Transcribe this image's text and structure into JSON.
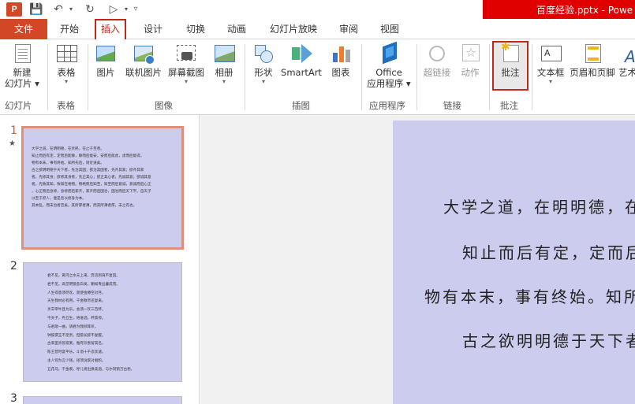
{
  "window": {
    "title": "百度经验.pptx - Powe",
    "logo": "P"
  },
  "tabs": [
    "文件",
    "开始",
    "插入",
    "设计",
    "切换",
    "动画",
    "幻灯片放映",
    "审阅",
    "视图"
  ],
  "ribbon": {
    "new_slide_1": "新建",
    "new_slide_2": "幻灯片",
    "table": "表格",
    "picture": "图片",
    "online_picture": "联机图片",
    "screenshot": "屏幕截图",
    "album": "相册",
    "shapes": "形状",
    "smartart": "SmartArt",
    "chart": "图表",
    "office_apps_1": "Office",
    "office_apps_2": "应用程序",
    "hyperlink": "超链接",
    "action": "动作",
    "comment": "批注",
    "textbox": "文本框",
    "header_footer": "页眉和页脚",
    "wordart": "艺术",
    "groups": {
      "slides": "幻灯片",
      "tables": "表格",
      "images": "图像",
      "illustrations": "插图",
      "apps": "应用程序",
      "links": "链接",
      "comments": "批注"
    }
  },
  "slides_panel": {
    "slide1_num": "1",
    "slide2_num": "2",
    "slide3_num": "3",
    "slide1_lines": [
      "大学之道，在明明德，在亲民，在止于至善。",
      "知止而后有定，定而后能静，静而后能安，安而后能虑，虑而后能得。",
      "物有本末，事有终始。知所先后，则近道矣。",
      "古之欲明明德于天下者，先治其国；欲治其国者，先齐其家；欲齐其家",
      "者，先修其身；欲修其身者，先正其心；欲正其心者，先诚其意；欲诚其意",
      "者，先致其知。致知在格物。物格而后知至，知至而后意诚，意诚而后心正",
      "，心正而后身修，身修而后家齐，家齐而后国治，国治而后天下平。自天子",
      "以至于庶人，壹是皆以修身为本。",
      "其本乱，而末治者否矣。其所厚者薄，而其所薄者厚，未之有也。"
    ],
    "slide2_lines": [
      "君不见，黄河之水天上来，奔流到海不复回。",
      "君不见，高堂明镜悲白发，朝如青丝暮成雪。",
      "人生得意须尽欢，莫使金樽空对月。",
      "天生我材必有用，千金散尽还复来。",
      "烹羊宰牛且为乐，会须一饮三百杯。",
      "岑夫子，丹丘生，将进酒，杯莫停。",
      "与君歌一曲，请君为我倾耳听。",
      "钟鼓馔玉不足贵，但愿长醉不复醒。",
      "古来圣贤皆寂寞，惟有饮者留其名。",
      "陈王昔时宴平乐，斗酒十千恣欢谑。",
      "主人何为言少钱，径须沽取对君酌。",
      "五花马，千金裘，呼儿将出换美酒，与尔同销万古愁。"
    ]
  },
  "main_slide": {
    "lines": [
      "大学之道，在明明德，在",
      "知止而后有定，定而后",
      "物有本末，事有终始。知所",
      "古之欲明明德于天下者"
    ]
  }
}
